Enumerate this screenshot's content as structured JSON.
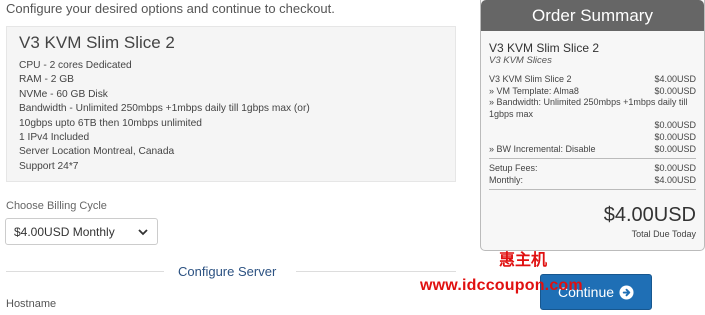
{
  "intro_text": "Configure your desired options and continue to checkout.",
  "product": {
    "title": "V3 KVM Slim Slice 2",
    "features": [
      "CPU - 2 cores Dedicated",
      "RAM - 2 GB",
      "NVMe - 60 GB Disk",
      "Bandwidth - Unlimited 250mbps +1mbps daily till 1gbps max (or)",
      "10gbps upto 6TB then 10mbps unlimited",
      "1 IPv4 Included",
      "Server Location Montreal, Canada",
      "Support 24*7"
    ]
  },
  "billing": {
    "label": "Choose Billing Cycle",
    "selected": "$4.00USD Monthly"
  },
  "configure_section": {
    "title": "Configure Server"
  },
  "hostname_label": "Hostname",
  "order_summary": {
    "header": "Order Summary",
    "product_name": "V3 KVM Slim Slice 2",
    "product_group": "V3 KVM Slices",
    "lines": [
      {
        "desc": "V3 KVM Slim Slice 2",
        "amount": "$4.00USD"
      },
      {
        "desc": "» VM Template: Alma8",
        "amount": "$0.00USD"
      },
      {
        "desc": "» Bandwidth: Unlimited 250mbps +1mbps daily till 1gbps max",
        "amount": ""
      },
      {
        "desc": "",
        "amount": "$0.00USD"
      },
      {
        "desc": "",
        "amount": "$0.00USD"
      },
      {
        "desc": "» BW Incremental: Disable",
        "amount": "$0.00USD"
      }
    ],
    "fees": [
      {
        "desc": "Setup Fees:",
        "amount": "$0.00USD"
      },
      {
        "desc": "Monthly:",
        "amount": "$4.00USD"
      }
    ],
    "total_price": "$4.00USD",
    "total_label": "Total Due Today"
  },
  "continue_button": {
    "label": "Continue"
  },
  "watermark": {
    "chinese": "惠主机",
    "url": "www.idccoupon.com"
  },
  "colors": {
    "summary_header": "#666666",
    "button": "#1f6fb5",
    "section_title": "#2c5282",
    "watermark": "#e01010"
  }
}
